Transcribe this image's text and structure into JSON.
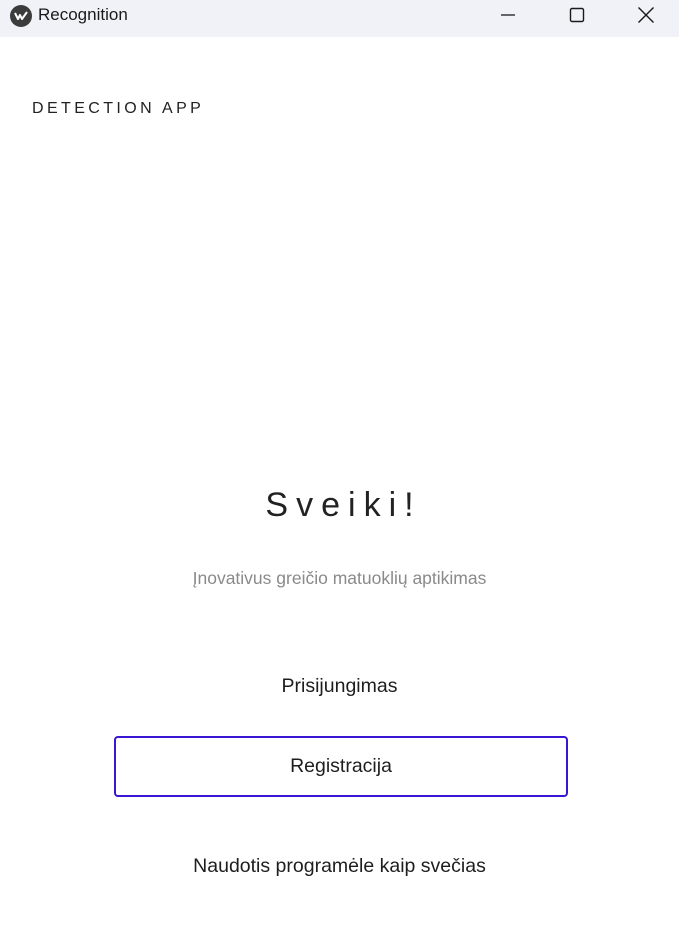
{
  "window": {
    "title": "Recognition",
    "controls": {
      "minimize": "minimize-icon",
      "maximize": "maximize-icon",
      "close": "close-icon"
    }
  },
  "header": {
    "brand": "DETECTION APP"
  },
  "main": {
    "welcome": "Sveiki!",
    "subtitle": "Įnovativus greičio matuoklių aptikimas",
    "login_label": "Prisijungimas",
    "register_label": "Registracija",
    "guest_label": "Naudotis programėle kaip svečias"
  },
  "colors": {
    "accent_border": "#3a16d4",
    "titlebar_bg": "#f0f2f8",
    "subtitle_text": "#8a8a8a"
  }
}
